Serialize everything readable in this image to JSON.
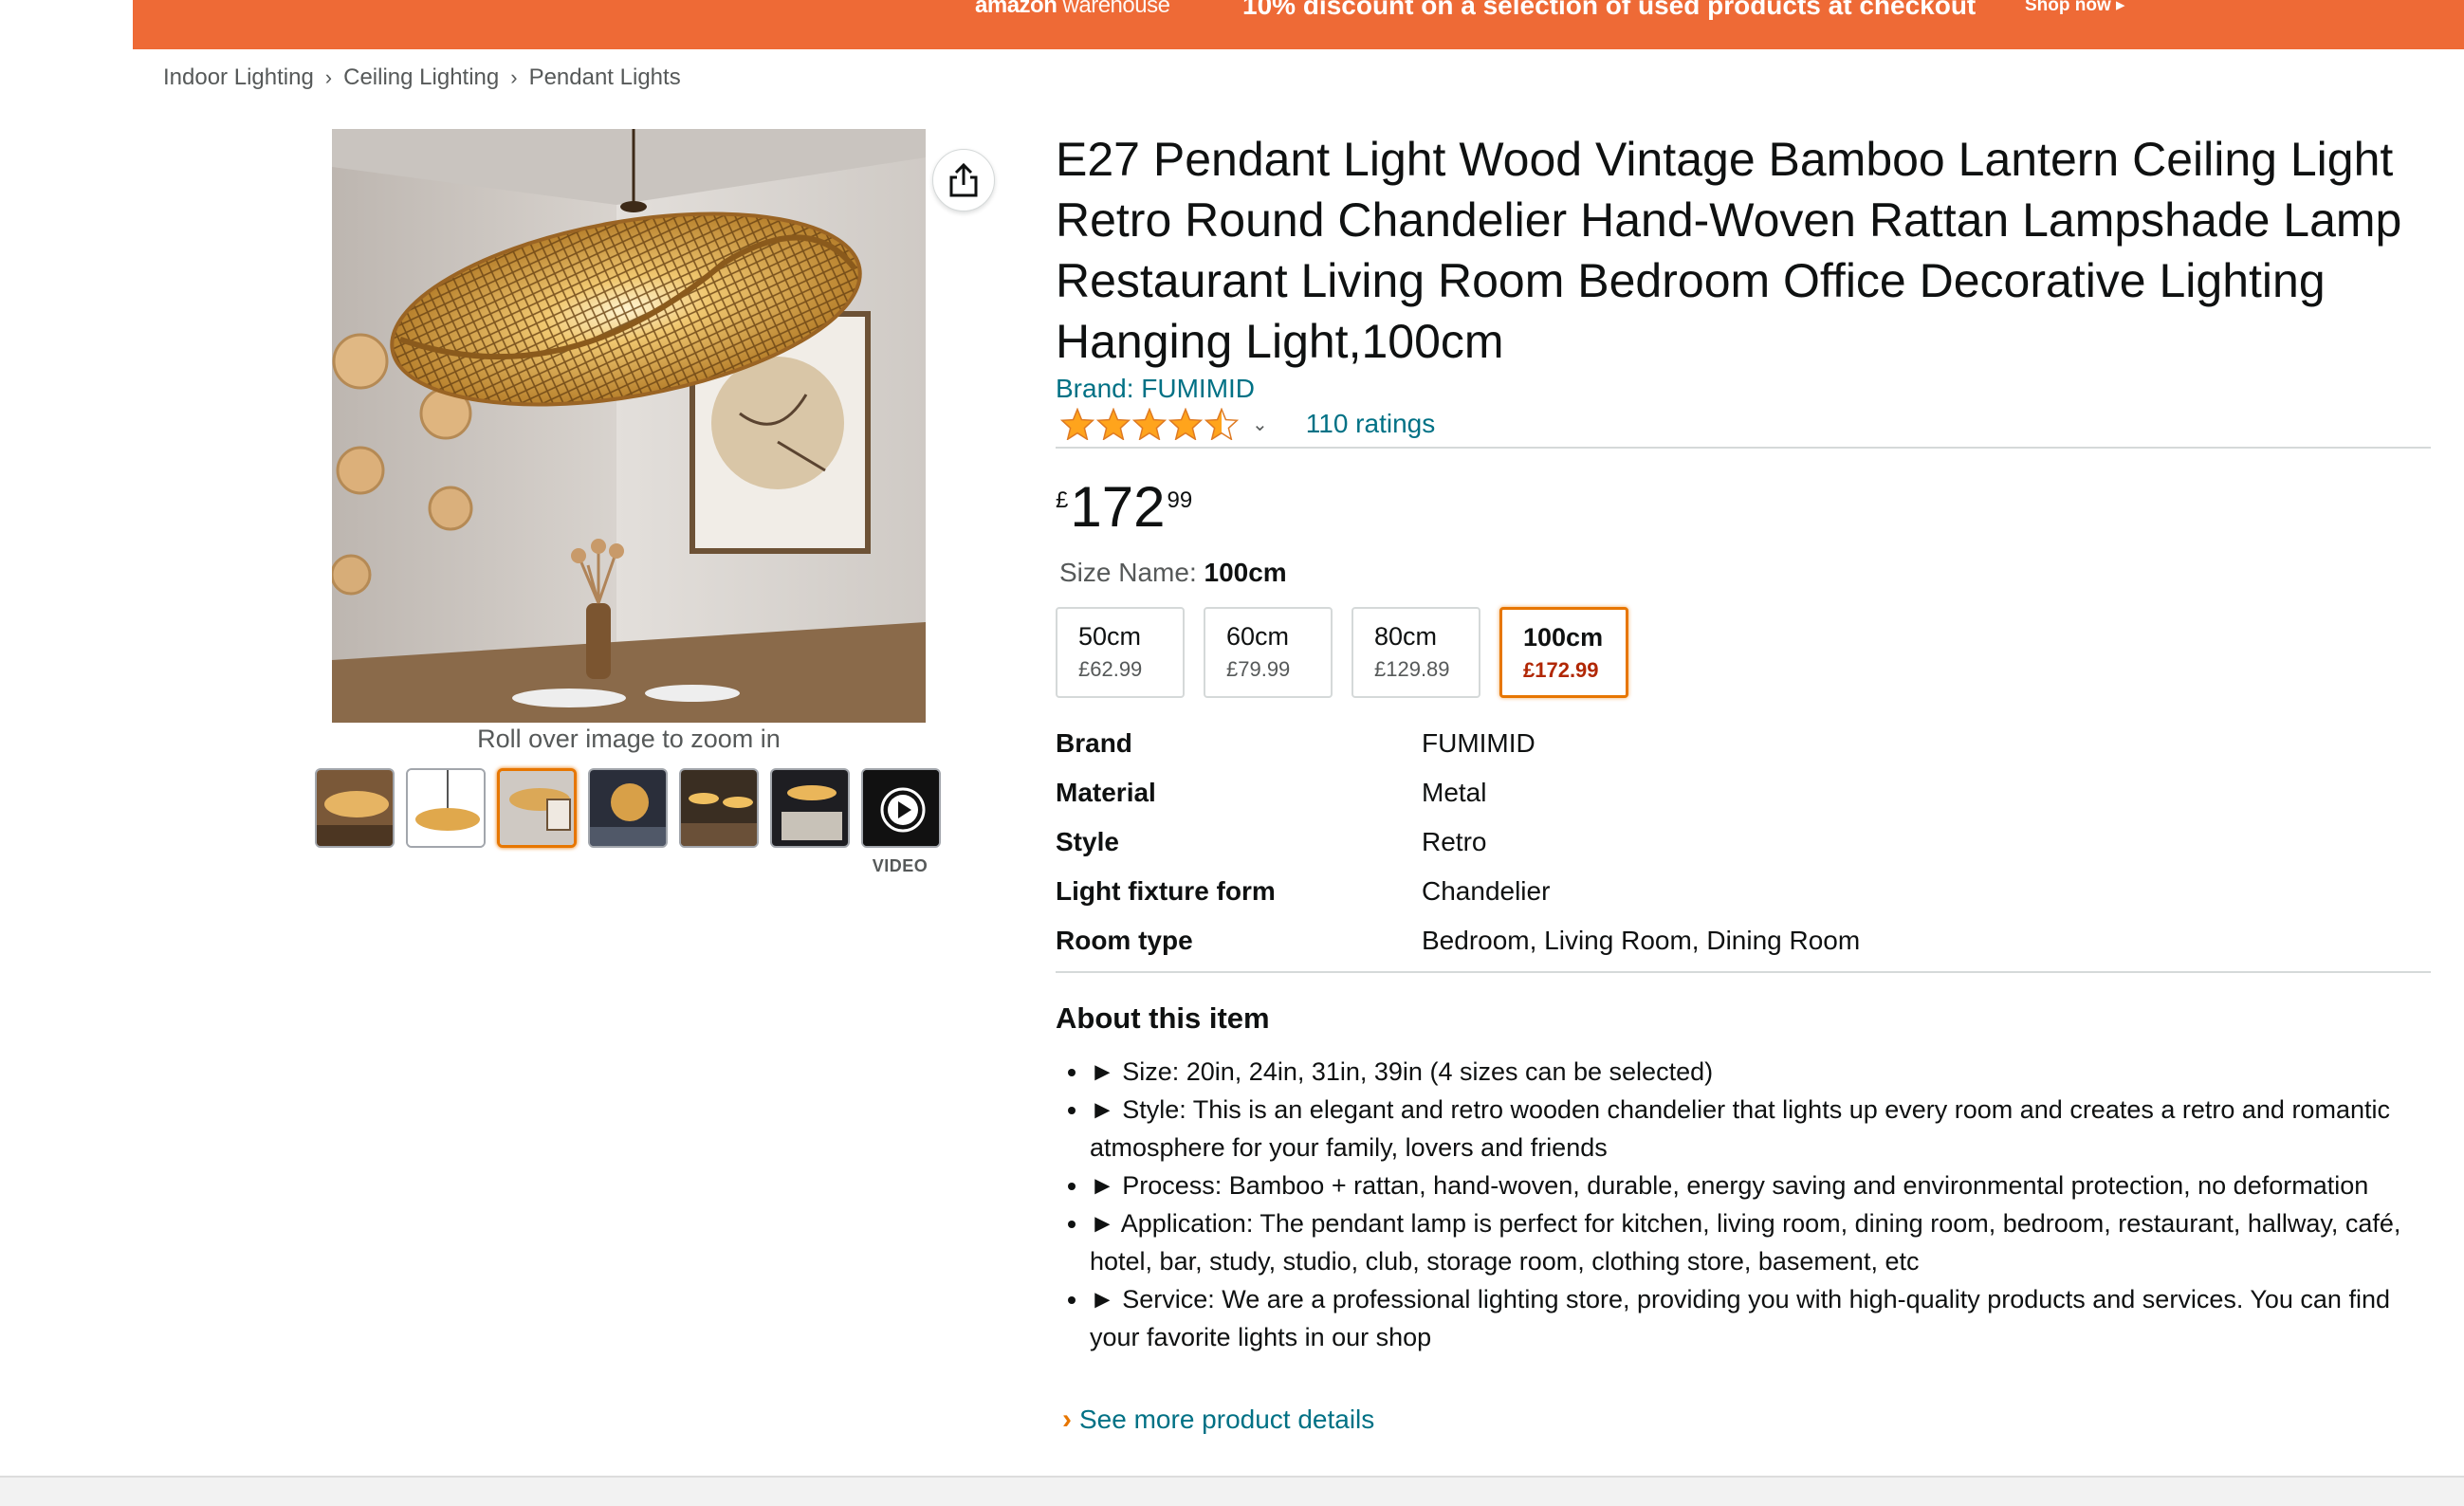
{
  "banner": {
    "logo_brand": "amazon",
    "logo_sub": "warehouse",
    "message": "10% discount on a selection of used products at checkout",
    "cta": "Shop now ▸"
  },
  "breadcrumb": {
    "items": [
      "Indoor Lighting",
      "Ceiling Lighting",
      "Pendant Lights"
    ],
    "separator": "›"
  },
  "gallery": {
    "zoom_hint": "Roll over image to zoom in",
    "video_label": "VIDEO",
    "selected_thumb_index": 2,
    "icons": [
      "share-icon",
      "play-icon"
    ]
  },
  "product": {
    "title": "E27 Pendant Light Wood Vintage Bamboo Lantern Ceiling Light Retro Round Chandelier Hand-Woven Rattan Lampshade Lamp Restaurant Living Room Bedroom Office Decorative Lighting Hanging Light,100cm",
    "brand_link": "Brand: FUMIMID",
    "rating_stars": 4.5,
    "ratings_count": "110 ratings",
    "price": {
      "symbol": "£",
      "whole": "172",
      "fraction": "99"
    }
  },
  "size": {
    "label": "Size Name:",
    "selected": "100cm",
    "options": [
      {
        "label": "50cm",
        "price": "£62.99"
      },
      {
        "label": "60cm",
        "price": "£79.99"
      },
      {
        "label": "80cm",
        "price": "£129.89"
      },
      {
        "label": "100cm",
        "price": "£172.99"
      }
    ]
  },
  "specs": [
    {
      "key": "Brand",
      "value": "FUMIMID"
    },
    {
      "key": "Material",
      "value": "Metal"
    },
    {
      "key": "Style",
      "value": "Retro"
    },
    {
      "key": "Light fixture form",
      "value": "Chandelier"
    },
    {
      "key": "Room type",
      "value": "Bedroom, Living Room, Dining Room"
    }
  ],
  "about": {
    "title": "About this item",
    "bullets": [
      "► Size: 20in, 24in, 31in, 39in (4 sizes can be selected)",
      "► Style: This is an elegant and retro wooden chandelier that lights up every room and creates a retro and romantic atmosphere for your family, lovers and friends",
      "► Process: Bamboo + rattan, hand-woven, durable, energy saving and environmental protection, no deformation",
      "► Application: The pendant lamp is perfect for kitchen, living room, dining room, bedroom, restaurant, hallway, café, hotel, bar, study, studio, club, storage room, clothing store, basement, etc",
      "► Service: We are a professional lighting store, providing you with high-quality products and services. You can find your favorite lights in our shop"
    ],
    "see_more": "See more product details"
  },
  "colors": {
    "banner": "#ee6a36",
    "link": "#007185",
    "star": "#ffa41c",
    "selected_border": "#e77600",
    "deal_price": "#b12704"
  }
}
